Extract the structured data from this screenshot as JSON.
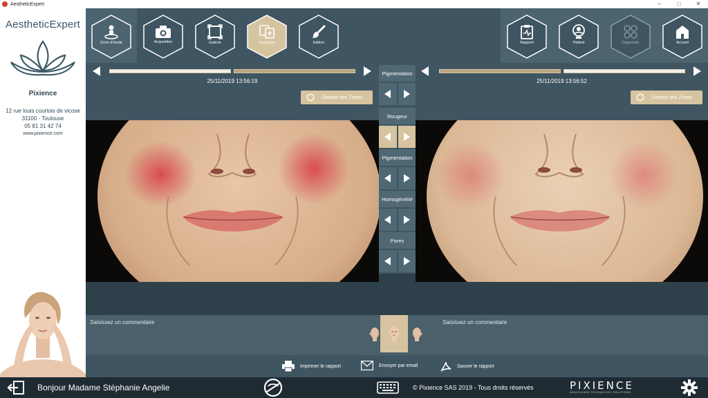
{
  "window": {
    "title": "AestheticExpert"
  },
  "sidebar": {
    "app_name": "AestheticExpert",
    "company": "Pixience",
    "address_street": "12 rue louis courtois de vicose",
    "address_city": "31100  -  Toulouse",
    "phone": "05 81 31 42 74",
    "website": "www.pixience.com"
  },
  "toolbar": {
    "left_buttons": [
      {
        "label": "Zone d'étude",
        "icon": "person-zone-icon",
        "active": false
      },
      {
        "label": "Acquisition",
        "icon": "camera-icon",
        "active": false
      },
      {
        "label": "Galerie",
        "icon": "gallery-icon",
        "active": false
      },
      {
        "label": "Comparer",
        "icon": "compare-icon",
        "active": true
      },
      {
        "label": "Edition",
        "icon": "brush-icon",
        "active": false
      }
    ],
    "right_buttons": [
      {
        "label": "Rapport",
        "icon": "report-icon",
        "disabled": false
      },
      {
        "label": "Patient",
        "icon": "patient-icon",
        "disabled": false
      },
      {
        "label": "Diagnostic",
        "icon": "diagnostic-icon",
        "disabled": true
      },
      {
        "label": "Accueil",
        "icon": "home-icon",
        "disabled": false
      }
    ]
  },
  "left_panel": {
    "timestamp": "25/11/2019 13:56:19",
    "zones_label": "Gestion des Zones",
    "comment_placeholder": "Saisissez un commentaire"
  },
  "right_panel": {
    "timestamp": "25/11/2019 13:56:52",
    "zones_label": "Gestion des Zones",
    "comment_placeholder": "Saisissez un commentaire"
  },
  "parameters": [
    {
      "label": "Pigmentation",
      "active": false
    },
    {
      "label": "Rougeur",
      "active": true
    },
    {
      "label": "Pigmentation",
      "active": false
    },
    {
      "label": "Homogénéité",
      "active": false
    },
    {
      "label": "Pores",
      "active": false
    }
  ],
  "actions": {
    "print": "Imprimer le rapport",
    "email": "Envoyer par email",
    "save": "Sauver le rapport"
  },
  "status": {
    "greeting": "Bonjour Madame Stéphanie Angelie",
    "copyright": "© Pixience SAS 2019 - Tous droits réservés",
    "logo_text": "PIXIENCE",
    "logo_sub": "HEALTHCARE TECHNOLOGY SOLUTIONS"
  },
  "colors": {
    "bg": "#3f5561",
    "accent": "#d6c4a0",
    "statusbar": "#1f2b33",
    "redness": "#d8283a"
  }
}
